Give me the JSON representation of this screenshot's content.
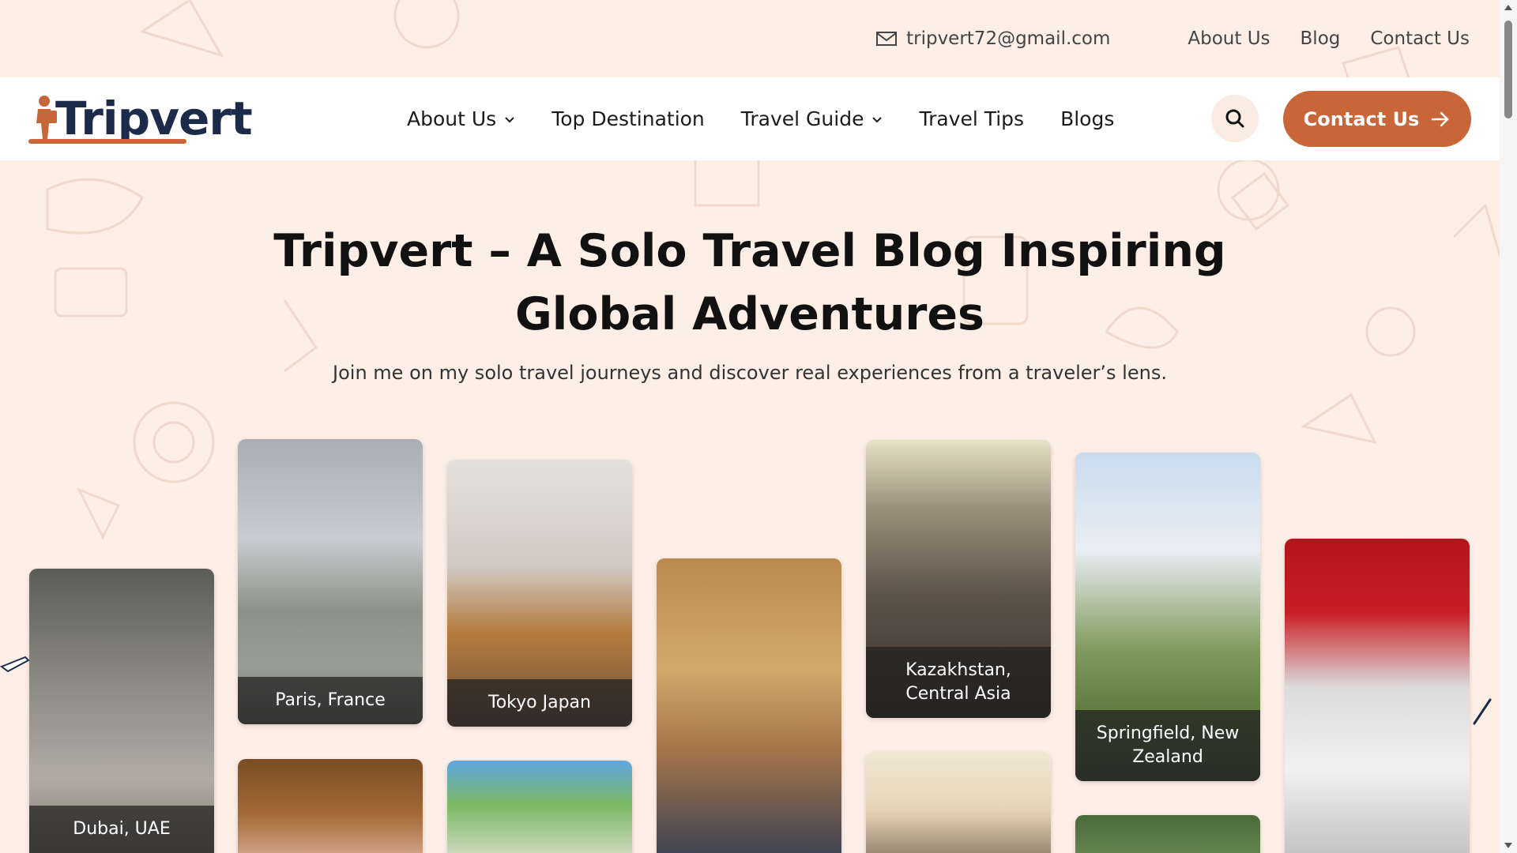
{
  "topbar": {
    "email": "tripvert72@gmail.com",
    "links": [
      "About Us",
      "Blog",
      "Contact Us"
    ]
  },
  "navbar": {
    "logo_text": "Tripvert",
    "menu": [
      {
        "label": "About Us",
        "dropdown": true
      },
      {
        "label": "Top Destination",
        "dropdown": false
      },
      {
        "label": "Travel Guide",
        "dropdown": true
      },
      {
        "label": "Travel Tips",
        "dropdown": false
      },
      {
        "label": "Blogs",
        "dropdown": false
      }
    ],
    "cta_label": "Contact Us"
  },
  "hero": {
    "title_line1": "Tripvert – A Solo Travel Blog Inspiring",
    "title_line2": "Global Adventures",
    "subtitle": "Join me on my solo travel journeys and discover real experiences from a traveler’s lens."
  },
  "cards": [
    {
      "caption": "Dubai, UAE"
    },
    {
      "caption": "Paris, France"
    },
    {
      "caption": "Tokyo Japan"
    },
    {
      "caption": ""
    },
    {
      "caption": "Kazakhstan, Central Asia"
    },
    {
      "caption": "Springfield, New Zealand"
    },
    {
      "caption": ""
    },
    {
      "caption": ""
    },
    {
      "caption": ""
    },
    {
      "caption": ""
    },
    {
      "caption": ""
    }
  ],
  "colors": {
    "accent": "#c8663a",
    "background": "#fdeee6",
    "logo": "#1d2b4a"
  }
}
